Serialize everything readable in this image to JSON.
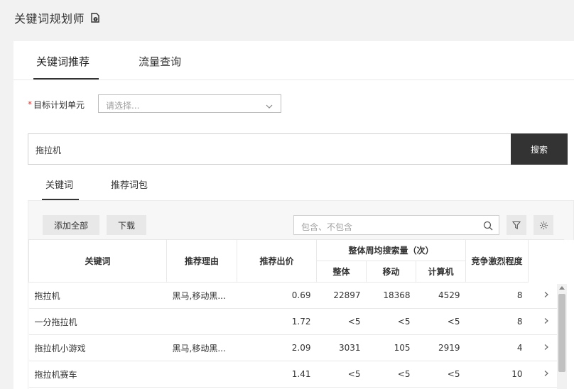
{
  "app": {
    "title": "关键词规划师",
    "help_icon": "help-doc-icon"
  },
  "main_tabs": [
    {
      "label": "关键词推荐",
      "active": true
    },
    {
      "label": "流量查询",
      "active": false
    }
  ],
  "form": {
    "required_mark": "*",
    "plan_label": "目标计划单元",
    "plan_placeholder": "请选择..."
  },
  "search": {
    "value": "拖拉机",
    "button_label": "搜索"
  },
  "sub_tabs": [
    {
      "label": "关键词",
      "active": true
    },
    {
      "label": "推荐词包",
      "active": false
    }
  ],
  "toolbar": {
    "add_all_label": "添加全部",
    "download_label": "下载",
    "filter_placeholder": "包含、不包含",
    "filter_icon": "funnel-icon",
    "settings_icon": "gear-icon"
  },
  "table": {
    "headers": {
      "keyword": "关键词",
      "reason": "推荐理由",
      "bid": "推荐出价",
      "weekly_search": "整体周均搜索量（次）",
      "overall": "整体",
      "mobile": "移动",
      "pc": "计算机",
      "competition": "竞争激烈程度"
    },
    "rows": [
      {
        "keyword": "拖拉机",
        "reason": "黑马,移动黑...",
        "bid": "0.69",
        "overall": "22897",
        "mobile": "18368",
        "pc": "4529",
        "competition": "8"
      },
      {
        "keyword": "一分拖拉机",
        "reason": "",
        "bid": "1.72",
        "overall": "<5",
        "mobile": "<5",
        "pc": "<5",
        "competition": "8"
      },
      {
        "keyword": "拖拉机小游戏",
        "reason": "黑马,移动黑...",
        "bid": "2.09",
        "overall": "3031",
        "mobile": "105",
        "pc": "2919",
        "competition": "4"
      },
      {
        "keyword": "拖拉机赛车",
        "reason": "",
        "bid": "1.41",
        "overall": "<5",
        "mobile": "<5",
        "pc": "<5",
        "competition": "10"
      }
    ]
  }
}
